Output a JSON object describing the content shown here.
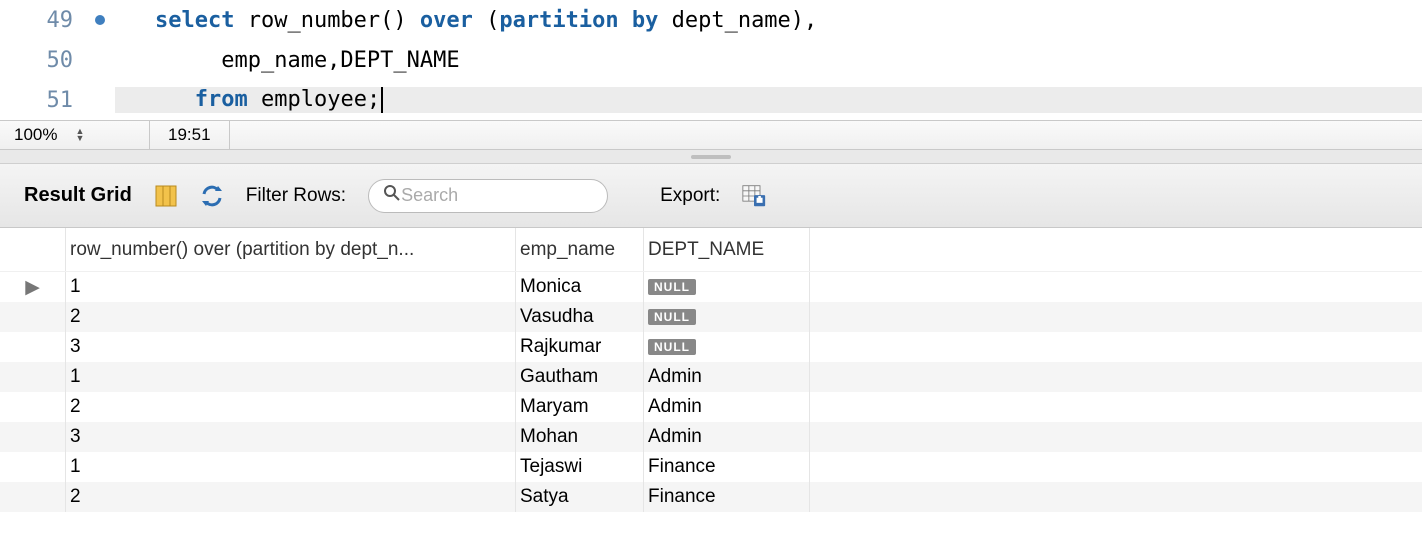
{
  "editor": {
    "lines": [
      {
        "num": "49",
        "marked": true,
        "segments": [
          {
            "t": "select ",
            "c": "kw"
          },
          {
            "t": "row_number",
            "c": "fn"
          },
          {
            "t": "() ",
            "c": "plain"
          },
          {
            "t": "over ",
            "c": "kw"
          },
          {
            "t": "(",
            "c": "plain"
          },
          {
            "t": "partition by ",
            "c": "kw"
          },
          {
            "t": "dept_name),",
            "c": "plain"
          }
        ],
        "indent": "",
        "highlight": false
      },
      {
        "num": "50",
        "marked": false,
        "segments": [
          {
            "t": "     emp_name,DEPT_NAME",
            "c": "plain"
          }
        ],
        "highlight": false
      },
      {
        "num": "51",
        "marked": false,
        "segments": [
          {
            "t": "   ",
            "c": "plain"
          },
          {
            "t": "from ",
            "c": "kw"
          },
          {
            "t": "employee;",
            "c": "plain"
          }
        ],
        "highlight": true,
        "cursor": true
      }
    ]
  },
  "status": {
    "zoom": "100%",
    "cursor_pos": "19:51"
  },
  "result": {
    "title": "Result Grid",
    "filter_label": "Filter Rows:",
    "search_placeholder": "Search",
    "export_label": "Export:",
    "columns": [
      "row_number() over (partition by dept_n...",
      "emp_name",
      "DEPT_NAME"
    ],
    "rows": [
      {
        "current": true,
        "cells": [
          "1",
          "Monica",
          null
        ]
      },
      {
        "current": false,
        "cells": [
          "2",
          "Vasudha",
          null
        ]
      },
      {
        "current": false,
        "cells": [
          "3",
          "Rajkumar",
          null
        ]
      },
      {
        "current": false,
        "cells": [
          "1",
          "Gautham",
          "Admin"
        ]
      },
      {
        "current": false,
        "cells": [
          "2",
          "Maryam",
          "Admin"
        ]
      },
      {
        "current": false,
        "cells": [
          "3",
          "Mohan",
          "Admin"
        ]
      },
      {
        "current": false,
        "cells": [
          "1",
          "Tejaswi",
          "Finance"
        ]
      },
      {
        "current": false,
        "cells": [
          "2",
          "Satya",
          "Finance"
        ]
      }
    ],
    "null_label": "NULL"
  }
}
